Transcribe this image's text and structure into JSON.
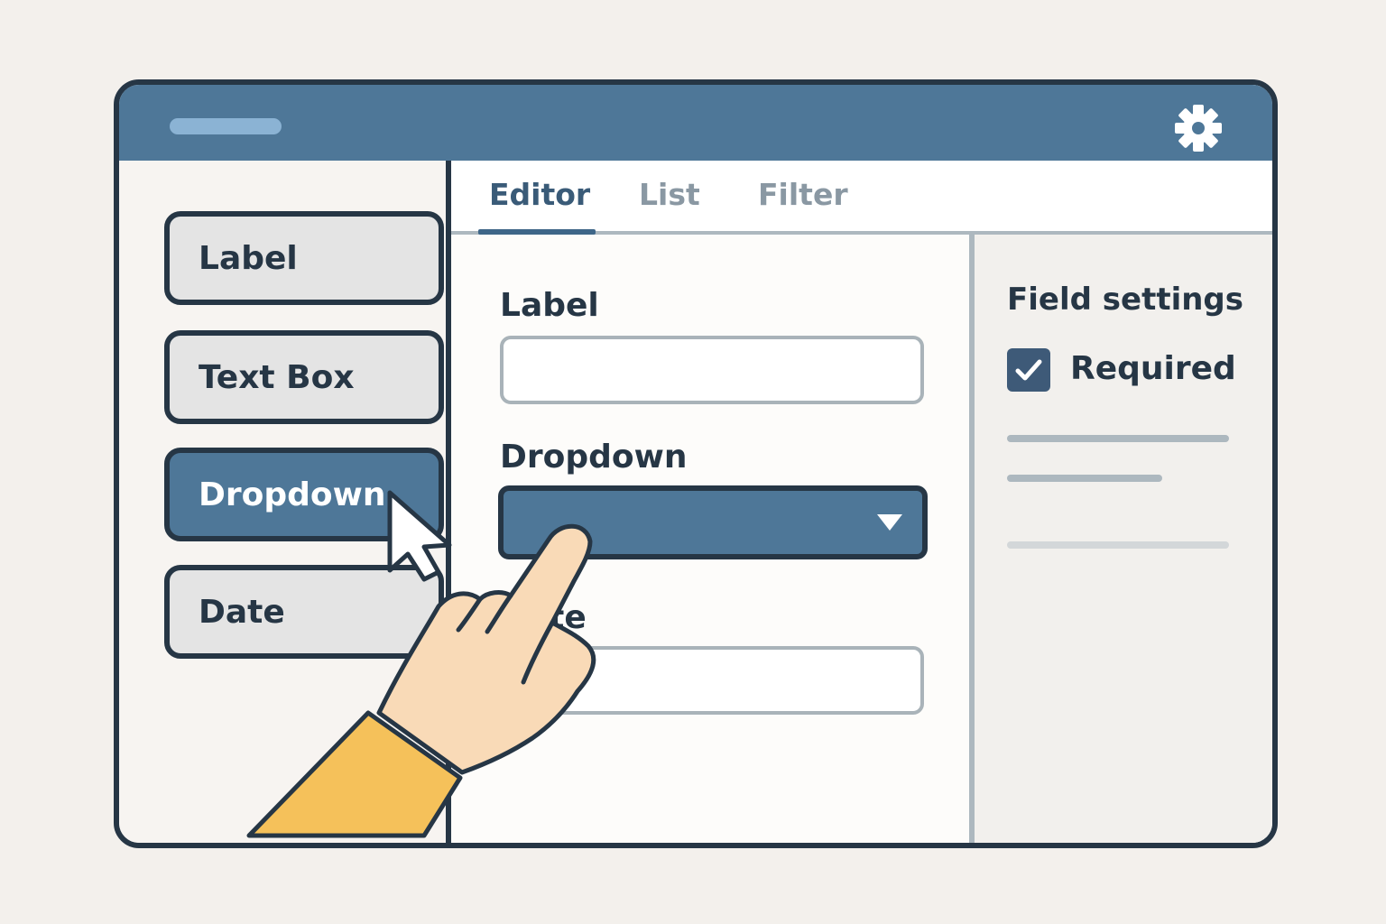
{
  "titlebar": {
    "settings_icon": "gear-icon"
  },
  "palette": {
    "items": [
      {
        "label": "Label",
        "active": false
      },
      {
        "label": "Text Box",
        "active": false
      },
      {
        "label": "Dropdown",
        "active": true
      },
      {
        "label": "Date",
        "active": false
      }
    ]
  },
  "tabs": [
    {
      "label": "Editor",
      "active": true
    },
    {
      "label": "List",
      "active": false
    },
    {
      "label": "Filter",
      "active": false
    }
  ],
  "editor": {
    "fields": [
      {
        "label": "Label",
        "type": "text",
        "value": ""
      },
      {
        "label": "Dropdown",
        "type": "dropdown",
        "value": ""
      },
      {
        "label": "Date",
        "type": "text",
        "value": ""
      }
    ]
  },
  "settings": {
    "title": "Field settings",
    "required_label": "Required",
    "required_checked": true
  },
  "colors": {
    "accent": "#4e7798",
    "outline": "#263645",
    "background": "#f3f0ec",
    "sleeve": "#f5c15a",
    "skin": "#f9dab7"
  }
}
